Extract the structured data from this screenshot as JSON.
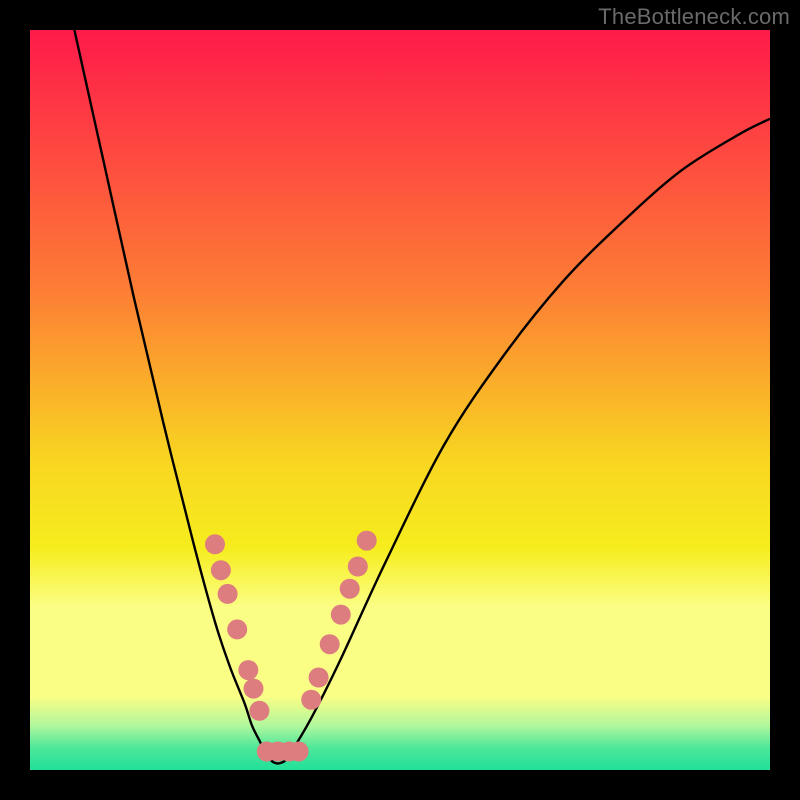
{
  "watermark": "TheBottleneck.com",
  "chart_data": {
    "type": "line",
    "title": "",
    "xlabel": "",
    "ylabel": "",
    "xlim": [
      0,
      100
    ],
    "ylim": [
      0,
      100
    ],
    "grid": false,
    "series": [
      {
        "name": "curve",
        "x": [
          6,
          10,
          14,
          18,
          22,
          25,
          27,
          29,
          30,
          31,
          32,
          33,
          34,
          35,
          38,
          42,
          48,
          56,
          64,
          72,
          80,
          88,
          96,
          100
        ],
        "y": [
          100,
          82,
          64,
          47,
          31,
          20,
          14,
          9,
          6,
          4,
          2,
          1,
          1,
          2,
          7,
          15,
          28,
          44,
          56,
          66,
          74,
          81,
          86,
          88
        ]
      }
    ],
    "markers": [
      {
        "x": 25.0,
        "y": 30.5
      },
      {
        "x": 25.8,
        "y": 27.0
      },
      {
        "x": 26.7,
        "y": 23.8
      },
      {
        "x": 28.0,
        "y": 19.0
      },
      {
        "x": 29.5,
        "y": 13.5
      },
      {
        "x": 30.2,
        "y": 11.0
      },
      {
        "x": 31.0,
        "y": 8.0
      },
      {
        "x": 32.0,
        "y": 2.5
      },
      {
        "x": 33.5,
        "y": 2.5
      },
      {
        "x": 35.0,
        "y": 2.5
      },
      {
        "x": 36.3,
        "y": 2.5
      },
      {
        "x": 38.0,
        "y": 9.5
      },
      {
        "x": 39.0,
        "y": 12.5
      },
      {
        "x": 40.5,
        "y": 17.0
      },
      {
        "x": 42.0,
        "y": 21.0
      },
      {
        "x": 43.2,
        "y": 24.5
      },
      {
        "x": 44.3,
        "y": 27.5
      },
      {
        "x": 45.5,
        "y": 31.0
      }
    ],
    "gradient_stops": [
      {
        "offset": 0,
        "color": "#fe1a4a"
      },
      {
        "offset": 35,
        "color": "#fd7d35"
      },
      {
        "offset": 58,
        "color": "#f8d521"
      },
      {
        "offset": 70,
        "color": "#f6ed1e"
      },
      {
        "offset": 78,
        "color": "#fbfe85"
      },
      {
        "offset": 90,
        "color": "#fbfe85"
      },
      {
        "offset": 94,
        "color": "#b1f79c"
      },
      {
        "offset": 97,
        "color": "#4ee79a"
      },
      {
        "offset": 100,
        "color": "#21e099"
      }
    ],
    "marker_radius": 10
  }
}
